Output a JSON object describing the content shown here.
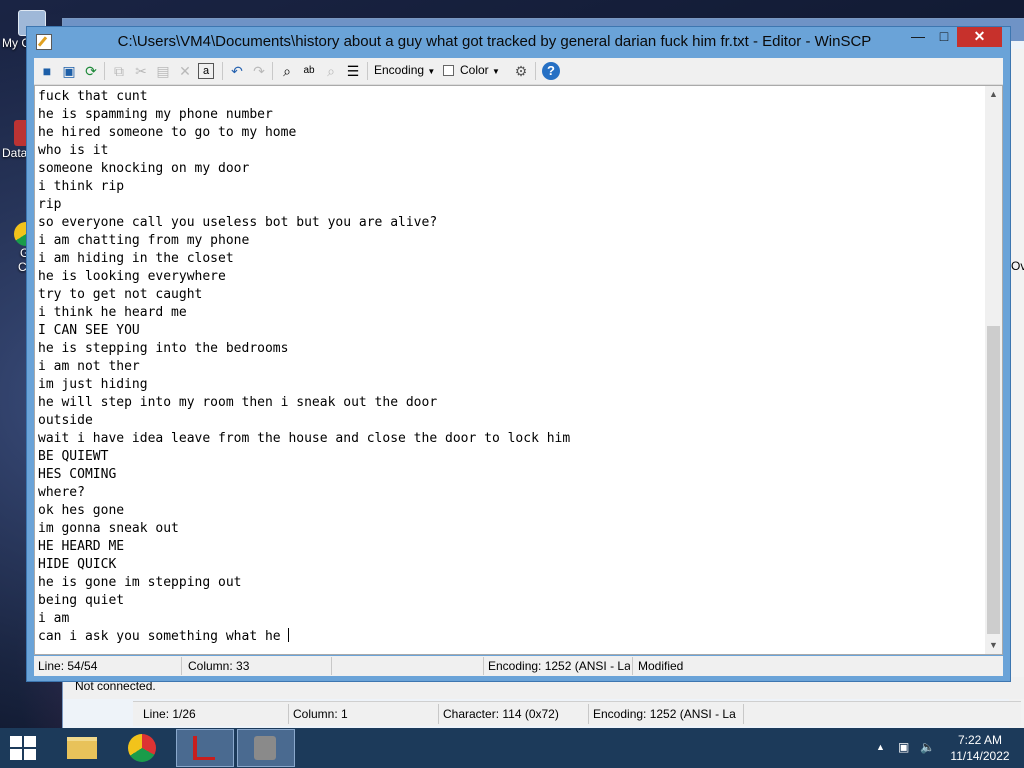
{
  "desktop": {
    "icons": [
      {
        "label": "My C"
      },
      {
        "label": "Data"
      },
      {
        "label": "G"
      },
      {
        "label": "C"
      }
    ]
  },
  "background_window": {
    "side_label": "Ov",
    "status_text": "Not connected.",
    "status2": {
      "line": "Line: 1/26",
      "column": "Column: 1",
      "character": "Character: 114 (0x72)",
      "encoding": "Encoding: 1252  (ANSI - La"
    }
  },
  "editor": {
    "title": "C:\\Users\\VM4\\Documents\\history about a guy what got tracked by general darian fuck him fr.txt - Editor - WinSCP",
    "toolbar": {
      "encoding_label": "Encoding",
      "color_label": "Color"
    },
    "lines": [
      "fuck that cunt",
      "he is spamming my phone number",
      "he hired someone to go to my home",
      "who is it",
      "someone knocking on my door",
      "i think rip",
      "rip",
      "so everyone call you useless bot but you are alive?",
      "i am chatting from my phone",
      "i am hiding in the closet",
      "he is looking everywhere",
      "try to get not caught",
      "i think he heard me",
      "I CAN SEE YOU",
      "he is stepping into the bedrooms",
      "i am not ther",
      "im just hiding",
      "he will step into my room then i sneak out the door",
      "outside",
      "wait i have idea leave from the house and close the door to lock him",
      "BE QUIEWT",
      "HES COMING",
      "where?",
      "ok hes gone",
      "im gonna sneak out",
      "HE HEARD ME",
      "HIDE QUICK",
      "he is gone im stepping out",
      "being quiet",
      "i am",
      "can i ask you something what he "
    ],
    "status": {
      "line": "Line: 54/54",
      "column": "Column: 33",
      "encoding": "Encoding: 1252  (ANSI - La",
      "modified": "Modified"
    }
  },
  "taskbar": {
    "time": "7:22 AM",
    "date": "11/14/2022"
  }
}
